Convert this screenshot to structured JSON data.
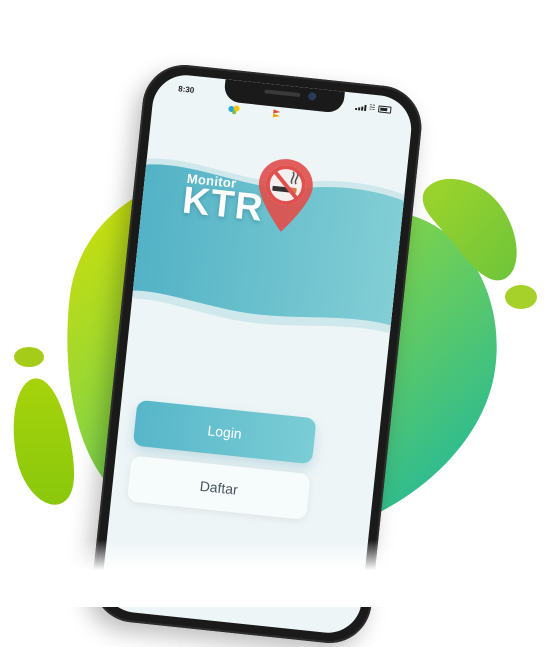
{
  "status_bar": {
    "time": "8:30"
  },
  "partners": [
    {
      "name": "partner-logo-1",
      "text": ""
    },
    {
      "name": "partner-logo-2",
      "text": ""
    }
  ],
  "app": {
    "title_small": "Monitor",
    "title_big": "KTR"
  },
  "actions": {
    "login_label": "Login",
    "register_label": "Daftar"
  },
  "colors": {
    "blob_yellow": "#d4df00",
    "blob_green": "#5cc96a",
    "blob_teal": "#19b5a6",
    "hero_teal": "#56b3c6",
    "pin_red": "#e0504e",
    "phone_frame": "#1a1a1a"
  },
  "icons": {
    "logo_pin": "no-smoking-pin-icon"
  }
}
